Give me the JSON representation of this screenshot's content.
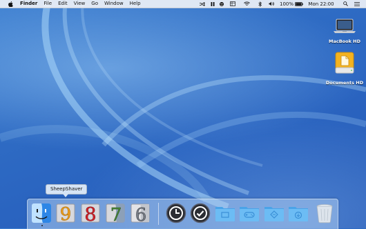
{
  "menubar": {
    "app_name": "Finder",
    "items": [
      "File",
      "Edit",
      "View",
      "Go",
      "Window",
      "Help"
    ],
    "battery_text": "100%",
    "clock_text": "Mon 22:00",
    "status_icons": [
      "shuffle-icon",
      "pause-icon",
      "virus-icon",
      "wifi-icon",
      "bluetooth-icon",
      "volume-icon",
      "battery-icon",
      "search-icon",
      "list-icon"
    ]
  },
  "desktop": {
    "icons": [
      {
        "label": "MacBook HD",
        "icon": "laptop-icon"
      },
      {
        "label": "Documents HD",
        "icon": "external-drive-icon"
      }
    ]
  },
  "dock": {
    "tooltip": "SheepShaver",
    "items": [
      {
        "name": "Finder",
        "icon": "finder-icon",
        "running": true
      },
      {
        "name": "SheepShaver",
        "icon": "mac-os-9-icon"
      },
      {
        "name": "Mac OS 8",
        "icon": "mac-os-8-icon"
      },
      {
        "name": "Mac OS 7",
        "icon": "mac-os-7-icon"
      },
      {
        "name": "Mac OS 6",
        "icon": "mac-os-6-icon"
      },
      {
        "name": "Time Machine",
        "icon": "clock-icon"
      },
      {
        "name": "Tasks",
        "icon": "checkmark-icon"
      },
      {
        "name": "Documents",
        "icon": "folder-icon"
      },
      {
        "name": "Games",
        "icon": "gamepad-folder-icon"
      },
      {
        "name": "Applications",
        "icon": "apps-folder-icon"
      },
      {
        "name": "Downloads",
        "icon": "downloads-folder-icon"
      },
      {
        "name": "Trash",
        "icon": "trash-icon"
      }
    ]
  },
  "colors": {
    "desktop": "#2f6cc4",
    "menubar": "#ecf0f6",
    "folder": "#5fb0ee"
  }
}
